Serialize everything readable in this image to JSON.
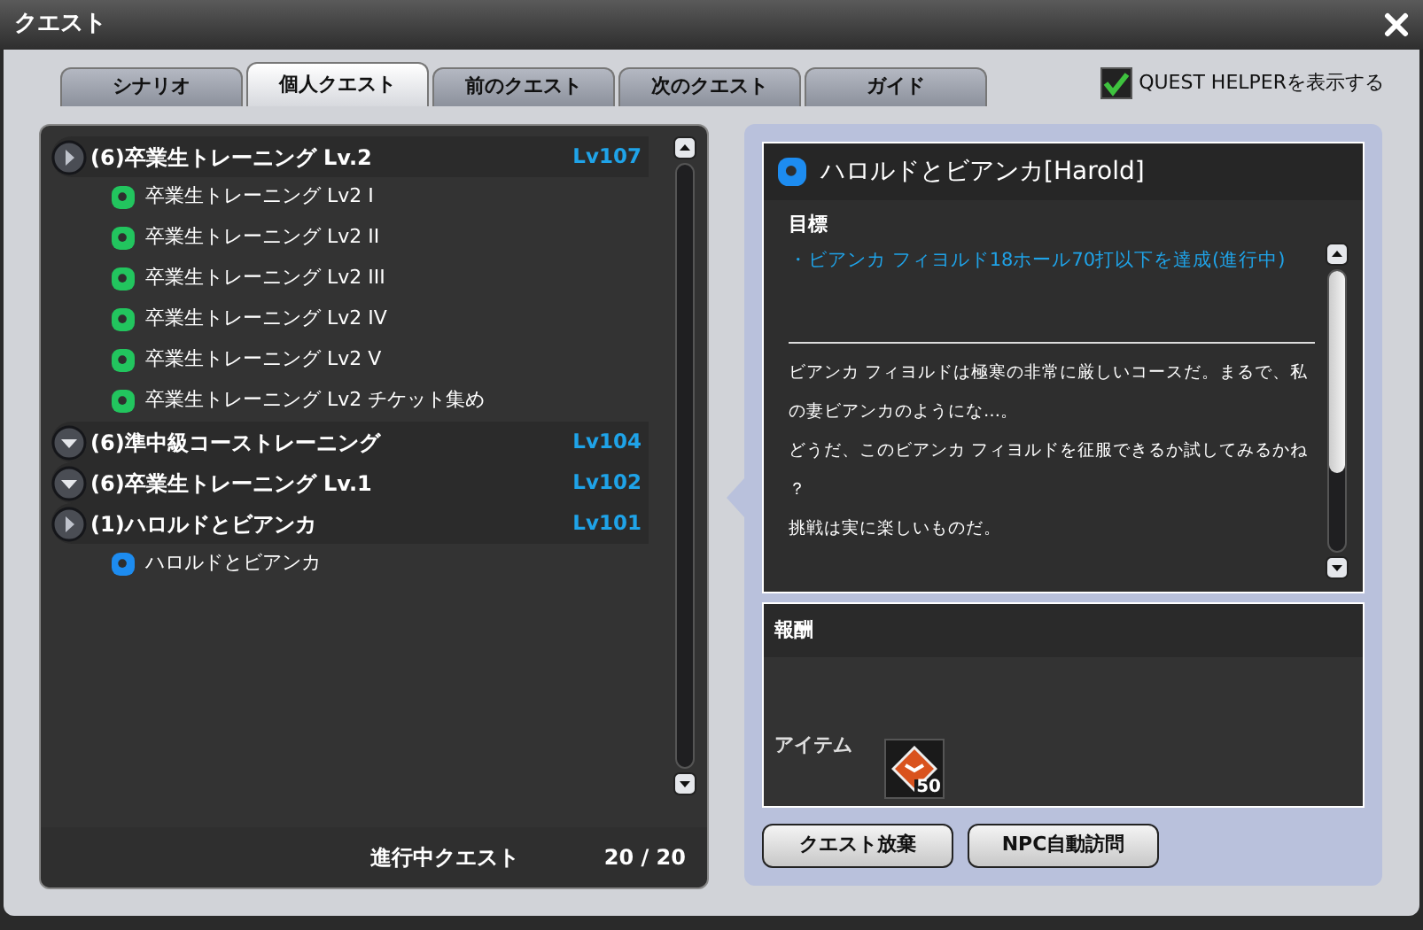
{
  "window": {
    "title": "クエスト"
  },
  "tabs": [
    {
      "label": "シナリオ",
      "selected": false
    },
    {
      "label": "個人クエスト",
      "selected": true
    },
    {
      "label": "前のクエスト",
      "selected": false
    },
    {
      "label": "次のクエスト",
      "selected": false
    },
    {
      "label": "ガイド",
      "selected": false
    }
  ],
  "quest_helper": {
    "label": "QUEST HELPERを表示する",
    "checked": true
  },
  "quest_tree": [
    {
      "name": "(6)卒業生トレーニング Lv.2",
      "level": "Lv107",
      "expanded": true,
      "children": [
        {
          "name": "卒業生トレーニング Lv2 I",
          "color": "#22c55e"
        },
        {
          "name": "卒業生トレーニング Lv2 II",
          "color": "#22c55e"
        },
        {
          "name": "卒業生トレーニング Lv2 III",
          "color": "#22c55e"
        },
        {
          "name": "卒業生トレーニング Lv2 IV",
          "color": "#22c55e"
        },
        {
          "name": "卒業生トレーニング Lv2 V",
          "color": "#22c55e"
        },
        {
          "name": "卒業生トレーニング Lv2 チケット集め",
          "color": "#22c55e"
        }
      ]
    },
    {
      "name": "(6)準中級コーストレーニング",
      "level": "Lv104",
      "expanded": false
    },
    {
      "name": "(6)卒業生トレーニング Lv.1",
      "level": "Lv102",
      "expanded": false
    },
    {
      "name": "(1)ハロルドとビアンカ",
      "level": "Lv101",
      "expanded": true,
      "children": [
        {
          "name": "ハロルドとビアンカ",
          "color": "#1d8cf0"
        }
      ]
    }
  ],
  "quest_count": {
    "label": "進行中クエスト",
    "value": "20 / 20"
  },
  "detail": {
    "title": "ハロルドとビアンカ[Harold]",
    "goal_heading": "目標",
    "goals": [
      "・ビアンカ フィヨルド18ホール70打以下を達成(進行中)"
    ],
    "description": [
      "ビアンカ フィヨルドは極寒の非常に厳しいコースだ。まるで、私の妻ビアンカのようにな…。",
      "どうだ、このビアンカ フィヨルドを征服できるか試してみるかね",
      "？",
      "挑戦は実に楽しいものだ。"
    ]
  },
  "reward": {
    "heading": "報酬",
    "item_label": "アイテム",
    "item_count": "50"
  },
  "buttons": [
    "クエスト放棄",
    "NPC自動訪問"
  ]
}
